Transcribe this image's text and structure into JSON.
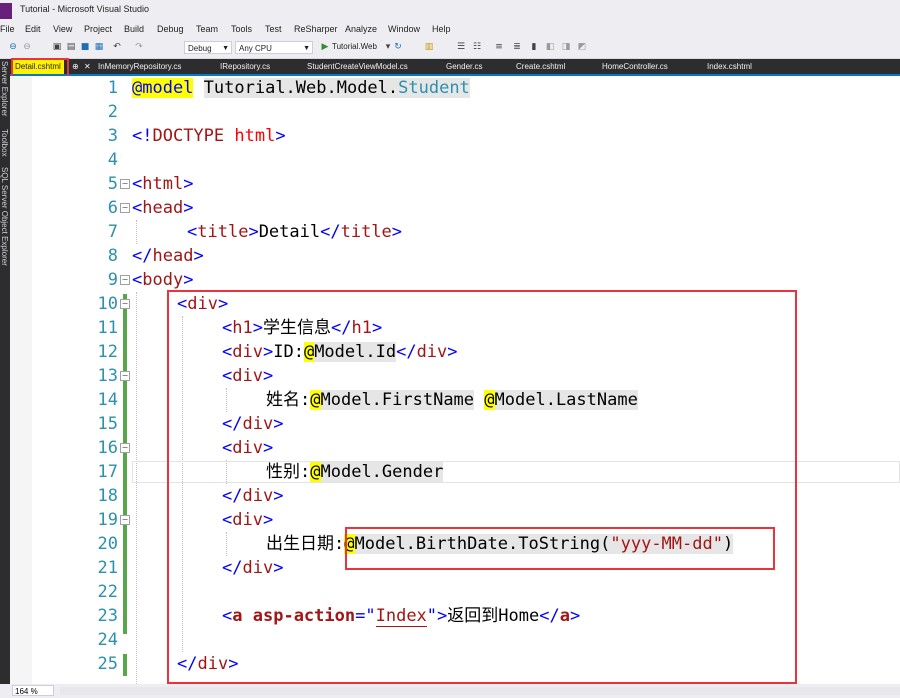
{
  "window": {
    "title": "Tutorial - Microsoft Visual Studio"
  },
  "menu": [
    "File",
    "Edit",
    "View",
    "Project",
    "Build",
    "Debug",
    "Team",
    "Tools",
    "Test",
    "ReSharper",
    "Analyze",
    "Window",
    "Help"
  ],
  "toolbar": {
    "config": "Debug",
    "platform": "Any CPU",
    "run_target": "Tutorial.Web"
  },
  "tabs": {
    "active": "Detail.cshtml",
    "others": [
      "InMemoryRepository.cs",
      "IRepository.cs",
      "StudentCreateViewModel.cs",
      "Gender.cs",
      "Create.cshtml",
      "HomeController.cs",
      "Index.cshtml"
    ]
  },
  "side_panels": [
    "Server Explorer",
    "Toolbox",
    "SQL Server Object Explorer"
  ],
  "line_numbers": [
    "1",
    "2",
    "3",
    "4",
    "5",
    "6",
    "7",
    "8",
    "9",
    "10",
    "11",
    "12",
    "13",
    "14",
    "15",
    "16",
    "17",
    "18",
    "19",
    "20",
    "21",
    "22",
    "23",
    "24",
    "25"
  ],
  "code": {
    "l1_kw": "@model",
    "l1_ns": "Tutorial.Web.Model.",
    "l1_type": "Student",
    "doctype_open": "<!",
    "doctype_kw": "DOCTYPE",
    "doctype_html": "html",
    "doctype_close": ">",
    "lt": "<",
    "gt": ">",
    "lts": "</",
    "html": "html",
    "head": "head",
    "title": "title",
    "title_text": "Detail",
    "body": "body",
    "div": "div",
    "h1": "h1",
    "h1_text": "学生信息",
    "at": "@",
    "id_label": "ID:",
    "model_id": "Model.Id",
    "name_label": "姓名:",
    "model_first": "Model.FirstName",
    "space": " ",
    "model_last": "Model.LastName",
    "gender_label": "性别:",
    "model_gender": "Model.Gender",
    "birth_label": "出生日期:",
    "birth_expr": "Model.BirthDate.ToString(",
    "birth_fmt": "\"yyy-MM-dd\"",
    "birth_close": ")",
    "a": "a",
    "asp_action": "asp-action",
    "eq": "=",
    "quote": "\"",
    "index": "Index",
    "a_text": "返回到Home"
  },
  "status": {
    "zoom": "164 %"
  }
}
